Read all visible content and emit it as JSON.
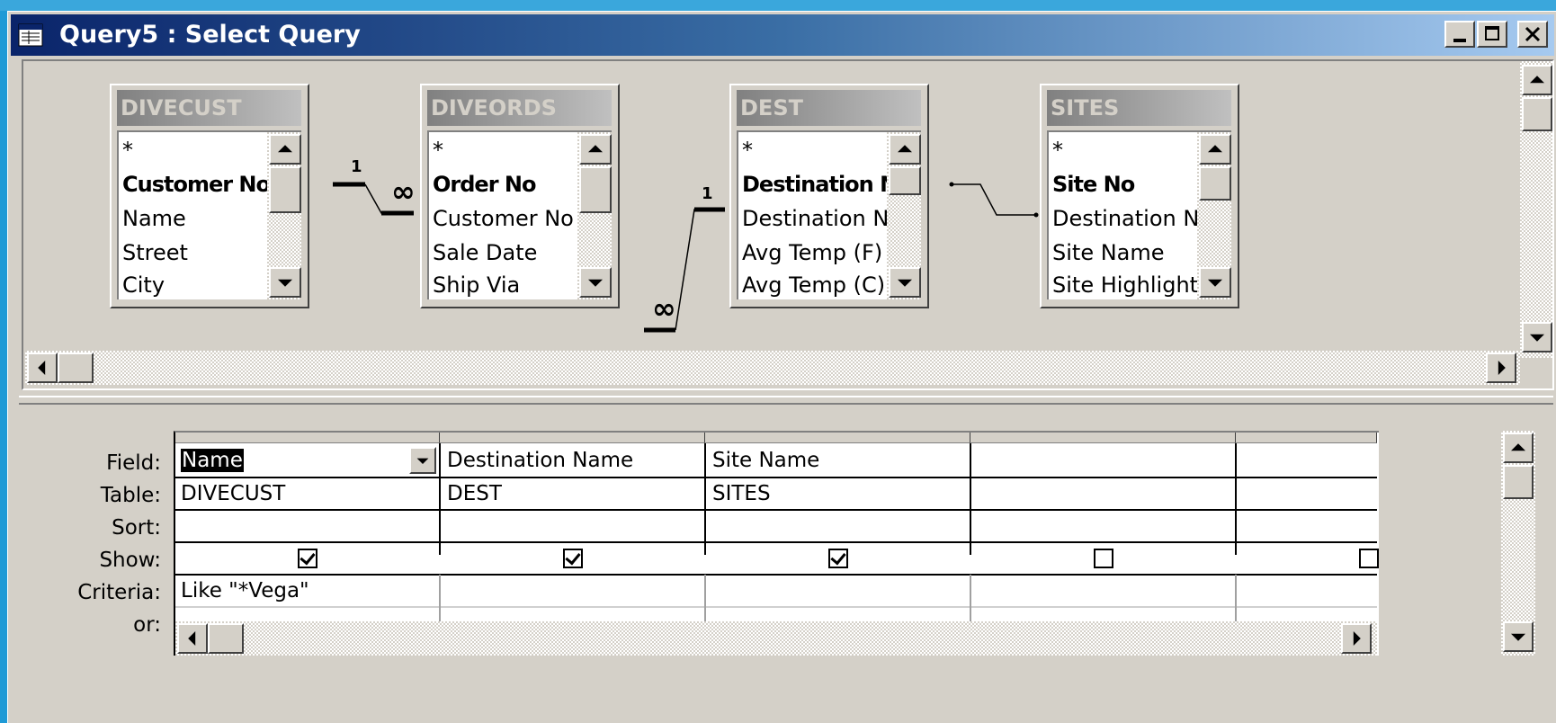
{
  "window": {
    "title": "Query5 : Select Query"
  },
  "tables": [
    {
      "name": "DIVECUST",
      "fields": [
        "*",
        "Customer No",
        "Name",
        "Street",
        "City"
      ],
      "bold": [
        1
      ]
    },
    {
      "name": "DIVEORDS",
      "fields": [
        "*",
        "Order No",
        "Customer No",
        "Sale Date",
        "Ship Via"
      ],
      "bold": [
        1
      ]
    },
    {
      "name": "DEST",
      "fields": [
        "*",
        "Destination No",
        "Destination Name",
        "Avg Temp (F)",
        "Avg Temp (C)"
      ],
      "bold": [
        1
      ]
    },
    {
      "name": "SITES",
      "fields": [
        "*",
        "Site No",
        "Destination No",
        "Site Name",
        "Site Highlight"
      ],
      "bold": [
        1
      ]
    }
  ],
  "relationships": [
    {
      "one_label": "1",
      "many_label": "∞"
    },
    {
      "one_label": "1",
      "many_label": "∞"
    }
  ],
  "grid": {
    "row_labels": {
      "field": "Field:",
      "table": "Table:",
      "sort": "Sort:",
      "show": "Show:",
      "criteria": "Criteria:",
      "or": "or:"
    },
    "columns": [
      {
        "field": "Name",
        "table": "DIVECUST",
        "sort": "",
        "show": true,
        "criteria": "Like \"*Vega\"",
        "or": ""
      },
      {
        "field": "Destination Name",
        "table": "DEST",
        "sort": "",
        "show": true,
        "criteria": "",
        "or": ""
      },
      {
        "field": "Site Name",
        "table": "SITES",
        "sort": "",
        "show": true,
        "criteria": "",
        "or": ""
      },
      {
        "field": "",
        "table": "",
        "sort": "",
        "show": false,
        "criteria": "",
        "or": ""
      },
      {
        "field": "",
        "table": "",
        "sort": "",
        "show": false,
        "criteria": "",
        "or": ""
      }
    ]
  }
}
